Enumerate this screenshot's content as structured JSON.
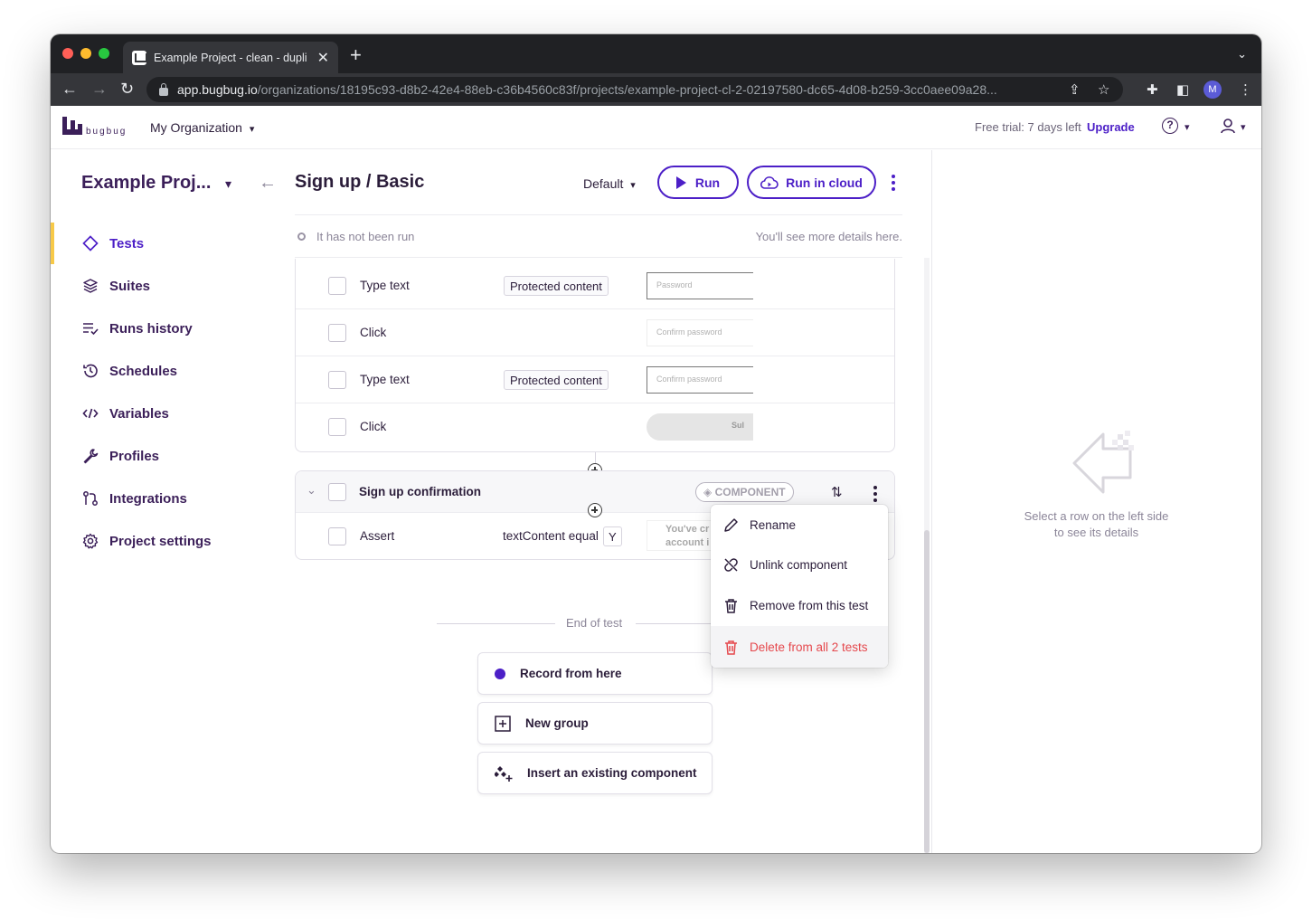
{
  "browser": {
    "tab_title": "Example Project - clean - dupli",
    "url_host": "app.bugbug.io",
    "url_path": "/organizations/18195c93-d8b2-42e4-88eb-c36b4560c83f/projects/example-project-cl-2-02197580-dc65-4d08-b259-3cc0aee09a28...",
    "profile_initial": "M"
  },
  "header": {
    "logo_text": "bugbug",
    "organization": "My Organization",
    "trial_text": "Free trial: 7 days left",
    "upgrade": "Upgrade",
    "help": "?"
  },
  "sidebar": {
    "project_title": "Example Proj...",
    "items": [
      {
        "label": "Tests",
        "icon": "diamond-icon"
      },
      {
        "label": "Suites",
        "icon": "layers-icon"
      },
      {
        "label": "Runs history",
        "icon": "list-check-icon"
      },
      {
        "label": "Schedules",
        "icon": "history-icon"
      },
      {
        "label": "Variables",
        "icon": "code-icon"
      },
      {
        "label": "Profiles",
        "icon": "wrench-icon"
      },
      {
        "label": "Integrations",
        "icon": "integrations-icon"
      },
      {
        "label": "Project settings",
        "icon": "gear-icon"
      }
    ]
  },
  "main": {
    "title": "Sign up / Basic",
    "profile": "Default",
    "run": "Run",
    "run_cloud": "Run in cloud",
    "status": "It has not been run",
    "status_hint": "You'll see more details here."
  },
  "steps": [
    {
      "label": "Type text",
      "tag": "Protected content",
      "thumb": "Password"
    },
    {
      "label": "Click",
      "tag": "",
      "thumb": "Confirm password"
    },
    {
      "label": "Type text",
      "tag": "Protected content",
      "thumb": "Confirm password"
    },
    {
      "label": "Click",
      "tag": "",
      "thumb": "Sul"
    }
  ],
  "component": {
    "title": "Sign up confirmation",
    "badge": "COMPONENT",
    "step_label": "Assert",
    "step_value": "textContent equal",
    "step_value_tail": "Y",
    "thumb_line1": "You've cr",
    "thumb_line2": "account i"
  },
  "end": {
    "label": "End of test",
    "record": "Record from here",
    "new_group": "New group",
    "insert": "Insert an existing component"
  },
  "menu": {
    "rename": "Rename",
    "unlink": "Unlink component",
    "remove": "Remove from this test",
    "delete": "Delete from all 2 tests"
  },
  "details": {
    "line1": "Select a row on the left side",
    "line2": "to see its details"
  },
  "colors": {
    "accent": "#4c1fc7",
    "brand": "#3b1f59",
    "active_marker": "#f7c948",
    "danger": "#e5484d"
  }
}
